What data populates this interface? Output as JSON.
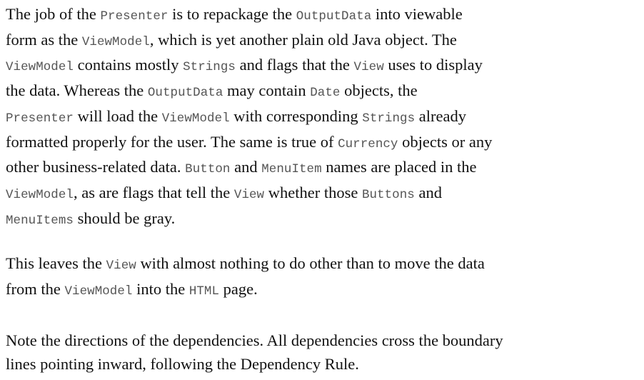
{
  "paragraphs": [
    {
      "lines": [
        [
          {
            "t": "The job of the ",
            "code": false
          },
          {
            "t": "Presenter",
            "code": true
          },
          {
            "t": " is to repackage the ",
            "code": false
          },
          {
            "t": "OutputData",
            "code": true
          },
          {
            "t": " into viewable",
            "code": false
          }
        ],
        [
          {
            "t": "form as the ",
            "code": false
          },
          {
            "t": "ViewModel",
            "code": true
          },
          {
            "t": ", which is yet another plain old Java object. The",
            "code": false
          }
        ],
        [
          {
            "t": "ViewModel",
            "code": true
          },
          {
            "t": " contains mostly ",
            "code": false
          },
          {
            "t": "Strings",
            "code": true
          },
          {
            "t": " and flags that the ",
            "code": false
          },
          {
            "t": "View",
            "code": true
          },
          {
            "t": " uses to display",
            "code": false
          }
        ],
        [
          {
            "t": "the data. Whereas the ",
            "code": false
          },
          {
            "t": "OutputData",
            "code": true
          },
          {
            "t": " may contain ",
            "code": false
          },
          {
            "t": "Date",
            "code": true
          },
          {
            "t": " objects, the",
            "code": false
          }
        ],
        [
          {
            "t": "Presenter",
            "code": true
          },
          {
            "t": " will load the ",
            "code": false
          },
          {
            "t": "ViewModel",
            "code": true
          },
          {
            "t": " with corresponding ",
            "code": false
          },
          {
            "t": "Strings",
            "code": true
          },
          {
            "t": " already",
            "code": false
          }
        ],
        [
          {
            "t": "formatted properly for the user. The same is true of ",
            "code": false
          },
          {
            "t": "Currency",
            "code": true
          },
          {
            "t": " objects or any",
            "code": false
          }
        ],
        [
          {
            "t": "other business-related data. ",
            "code": false
          },
          {
            "t": "Button",
            "code": true
          },
          {
            "t": " and ",
            "code": false
          },
          {
            "t": "MenuItem",
            "code": true
          },
          {
            "t": " names are placed in the",
            "code": false
          }
        ],
        [
          {
            "t": "ViewModel",
            "code": true
          },
          {
            "t": ", as are flags that tell the ",
            "code": false
          },
          {
            "t": "View",
            "code": true
          },
          {
            "t": " whether those ",
            "code": false
          },
          {
            "t": "Buttons",
            "code": true
          },
          {
            "t": " and",
            "code": false
          }
        ],
        [
          {
            "t": "MenuItems",
            "code": true
          },
          {
            "t": " should be gray.",
            "code": false
          }
        ]
      ]
    },
    {
      "lines": [
        [
          {
            "t": "This leaves the ",
            "code": false
          },
          {
            "t": "View",
            "code": true
          },
          {
            "t": " with almost nothing to do other than to move the data",
            "code": false
          }
        ],
        [
          {
            "t": "from the ",
            "code": false
          },
          {
            "t": "ViewModel",
            "code": true
          },
          {
            "t": " into the ",
            "code": false
          },
          {
            "t": "HTML",
            "code": true
          },
          {
            "t": " page.",
            "code": false
          }
        ]
      ]
    },
    {
      "lines": [
        [
          {
            "t": "Note the directions of the dependencies. All dependencies cross the boundary",
            "code": false
          }
        ],
        [
          {
            "t": "lines pointing inward, following the Dependency Rule.",
            "code": false
          }
        ]
      ]
    }
  ]
}
